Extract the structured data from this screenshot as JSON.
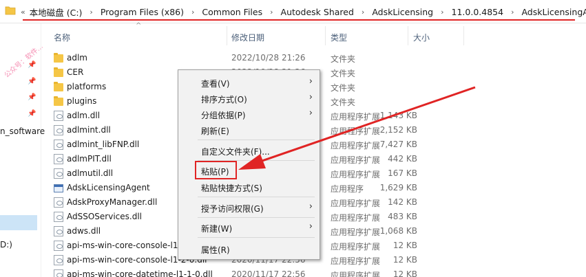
{
  "address": {
    "chevron": "«",
    "crumbs": [
      "本地磁盘 (C:)",
      "Program Files (x86)",
      "Common Files",
      "Autodesk Shared",
      "AdskLicensing",
      "11.0.0.4854",
      "AdskLicensingAgent"
    ],
    "accent_color": "#e02424"
  },
  "nav": {
    "texts": [
      "n_software",
      "D:)"
    ],
    "watermark": "公众号：软件..."
  },
  "headers": {
    "name": "名称",
    "date": "修改日期",
    "type": "类型",
    "size": "大小"
  },
  "files": [
    {
      "name": "adlm",
      "date": "2022/10/28 21:26",
      "type": "文件夹",
      "size": "",
      "icon": "folder-icon"
    },
    {
      "name": "CER",
      "date": "2022/10/28 21:26",
      "type": "文件夹",
      "size": "",
      "icon": "folder-icon"
    },
    {
      "name": "platforms",
      "date": "",
      "type": "文件夹",
      "size": "",
      "icon": "folder-icon"
    },
    {
      "name": "plugins",
      "date": "",
      "type": "文件夹",
      "size": "",
      "icon": "folder-icon"
    },
    {
      "name": "adlm.dll",
      "date": "",
      "type": "应用程序扩展",
      "size": "1,143 KB",
      "icon": "dll-file-icon"
    },
    {
      "name": "adlmint.dll",
      "date": "",
      "type": "应用程序扩展",
      "size": "2,152 KB",
      "icon": "dll-file-icon"
    },
    {
      "name": "adlmint_libFNP.dll",
      "date": "",
      "type": "应用程序扩展",
      "size": "7,427 KB",
      "icon": "dll-file-icon"
    },
    {
      "name": "adlmPIT.dll",
      "date": "",
      "type": "应用程序扩展",
      "size": "442 KB",
      "icon": "dll-file-icon"
    },
    {
      "name": "adlmutil.dll",
      "date": "",
      "type": "应用程序扩展",
      "size": "167 KB",
      "icon": "dll-file-icon"
    },
    {
      "name": "AdskLicensingAgent",
      "date": "",
      "type": "应用程序",
      "size": "1,629 KB",
      "icon": "exe-file-icon"
    },
    {
      "name": "AdskProxyManager.dll",
      "date": "",
      "type": "应用程序扩展",
      "size": "142 KB",
      "icon": "dll-file-icon"
    },
    {
      "name": "AdSSOServices.dll",
      "date": "",
      "type": "应用程序扩展",
      "size": "483 KB",
      "icon": "dll-file-icon"
    },
    {
      "name": "adws.dll",
      "date": "",
      "type": "应用程序扩展",
      "size": "1,068 KB",
      "icon": "dll-file-icon"
    },
    {
      "name": "api-ms-win-core-console-l1-",
      "date": "",
      "type": "应用程序扩展",
      "size": "12 KB",
      "icon": "dll-file-icon"
    },
    {
      "name": "api-ms-win-core-console-l1-2-0.dll",
      "date": "2020/11/17 22:56",
      "type": "应用程序扩展",
      "size": "12 KB",
      "icon": "dll-file-icon"
    },
    {
      "name": "api-ms-win-core-datetime-l1-1-0.dll",
      "date": "2020/11/17 22:56",
      "type": "应用程序扩展",
      "size": "12 KB",
      "icon": "dll-file-icon"
    }
  ],
  "context_menu": {
    "items": [
      {
        "label": "查看(V)",
        "submenu": true
      },
      {
        "label": "排序方式(O)",
        "submenu": true
      },
      {
        "label": "分组依据(P)",
        "submenu": true
      },
      {
        "label": "刷新(E)",
        "submenu": false
      },
      {
        "label": "自定义文件夹(F)...",
        "submenu": false
      },
      {
        "label": "粘贴(P)",
        "submenu": false
      },
      {
        "label": "粘贴快捷方式(S)",
        "submenu": false
      },
      {
        "label": "授予访问权限(G)",
        "submenu": true
      },
      {
        "label": "新建(W)",
        "submenu": true
      },
      {
        "label": "属性(R)",
        "submenu": false
      }
    ],
    "submenu_glyph": "›",
    "highlight_color": "#e02424"
  }
}
